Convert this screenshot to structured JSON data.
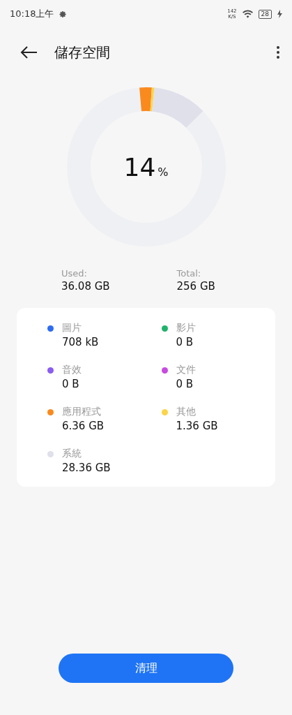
{
  "status_bar": {
    "time": "10:18上午",
    "speed_value": "142",
    "speed_unit": "K/S",
    "battery": "28"
  },
  "header": {
    "title": "儲存空間"
  },
  "usage": {
    "percent": "14",
    "percent_sign": "%"
  },
  "summary": [
    {
      "label": "Used:",
      "value": "36.08 GB"
    },
    {
      "label": "Total:",
      "value": "256 GB"
    }
  ],
  "categories": [
    {
      "label": "圖片",
      "size": "708 kB",
      "color": "#2f6bf0"
    },
    {
      "label": "影片",
      "size": "0 B",
      "color": "#20b36b"
    },
    {
      "label": "音效",
      "size": "0 B",
      "color": "#8a5cf0"
    },
    {
      "label": "文件",
      "size": "0 B",
      "color": "#c74be0"
    },
    {
      "label": "應用程式",
      "size": "6.36 GB",
      "color": "#fa8a1e",
      "level": 0.025
    },
    {
      "label": "其他",
      "size": "1.36 GB",
      "color": "#fbd548",
      "level": 0.005
    },
    {
      "label": "系統",
      "size": "28.36 GB",
      "color": "#dfe0ea",
      "level": 0.11
    }
  ],
  "action": {
    "label": "清理"
  }
}
